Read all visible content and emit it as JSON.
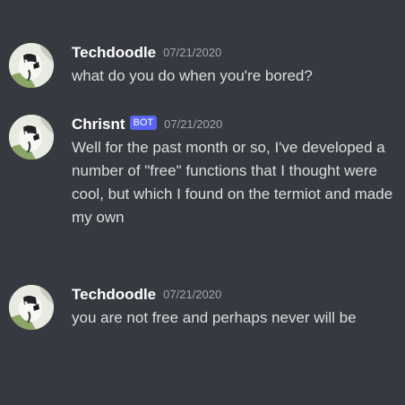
{
  "messages": [
    {
      "author": "Techdoodle",
      "avatar_icon": "user-avatar-icon",
      "bot": false,
      "timestamp": "07/21/2020",
      "text": "what do you do when you're bored?"
    },
    {
      "author": "Chrisnt",
      "avatar_icon": "user-avatar-icon",
      "bot": true,
      "bot_label": "BOT",
      "timestamp": "07/21/2020",
      "text": "Well for the past month or so, I've developed a number of \"free\" functions that I thought were cool, but which I found on the termiot and made my own"
    },
    {
      "author": "Techdoodle",
      "avatar_icon": "user-avatar-icon",
      "bot": false,
      "timestamp": "07/21/2020",
      "text": "you are not free and perhaps never will be"
    }
  ],
  "colors": {
    "background": "#36393f",
    "username": "#ffffff",
    "message_text": "#dcddde",
    "timestamp": "#a3a6aa",
    "bot_tag": "#5865f2"
  }
}
